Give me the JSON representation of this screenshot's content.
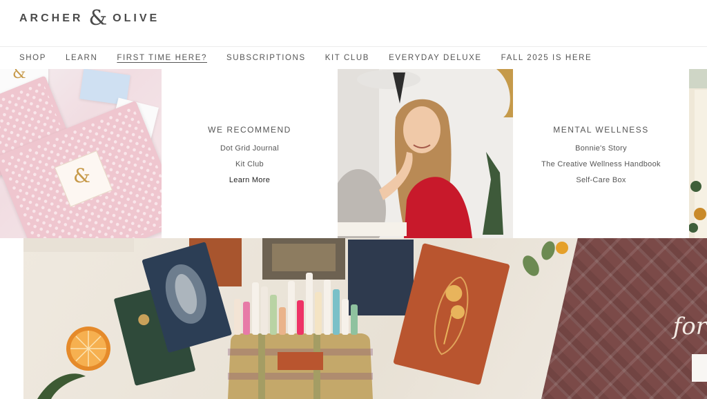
{
  "brand": {
    "word_left": "ARCHER",
    "amp": "&",
    "word_right": "OLIVE"
  },
  "nav": {
    "items": [
      {
        "label": "SHOP"
      },
      {
        "label": "LEARN"
      },
      {
        "label": "FIRST TIME HERE?",
        "active": true
      },
      {
        "label": "SUBSCRIPTIONS"
      },
      {
        "label": "KIT CLUB"
      },
      {
        "label": "EVERYDAY DELUXE"
      },
      {
        "label": "FALL 2025 IS HERE"
      }
    ]
  },
  "mega_menu": {
    "recommend": {
      "title": "WE RECOMMEND",
      "links": [
        "Dot Grid Journal",
        "Kit Club",
        "Learn More"
      ]
    },
    "wellness": {
      "title": "MENTAL WELLNESS",
      "links": [
        "Bonnie's Story",
        "The Creative Wellness Handbook",
        "Self-Care Box"
      ]
    }
  },
  "hero": {
    "text": "for"
  },
  "colors": {
    "plaid": "#7b4a48",
    "orange_notebook": "#b9552f",
    "navy_notebook": "#2c3e55",
    "green_notebook": "#2f4a3a"
  }
}
